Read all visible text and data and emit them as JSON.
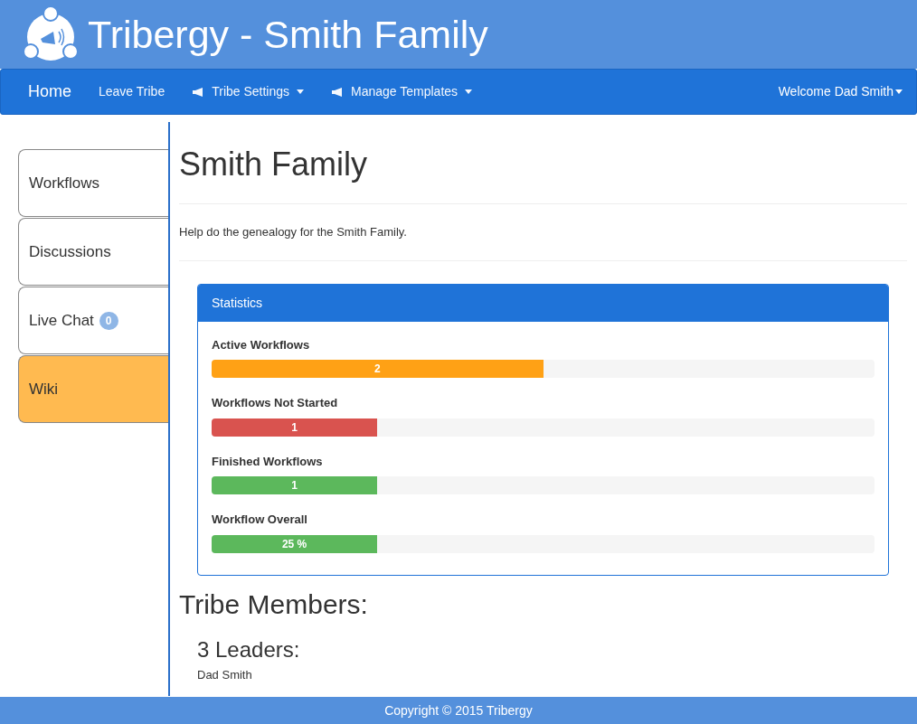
{
  "header": {
    "title": "Tribergy - Smith Family"
  },
  "navbar": {
    "items": [
      {
        "label": "Home",
        "selected": true,
        "icon": false,
        "dropdown": false
      },
      {
        "label": "Leave Tribe",
        "selected": false,
        "icon": false,
        "dropdown": false
      },
      {
        "label": "Tribe Settings",
        "selected": false,
        "icon": true,
        "dropdown": true
      },
      {
        "label": "Manage Templates",
        "selected": false,
        "icon": true,
        "dropdown": true
      }
    ],
    "user": {
      "label": "Welcome Dad Smith",
      "dropdown": true
    }
  },
  "sidebar": {
    "items": [
      {
        "label": "Workflows",
        "selected": false
      },
      {
        "label": "Discussions",
        "selected": false
      },
      {
        "label": "Live Chat",
        "selected": false,
        "badge": "0"
      },
      {
        "label": "Wiki",
        "selected": true
      }
    ]
  },
  "page": {
    "title": "Smith Family",
    "description": "Help do the genealogy for the Smith Family."
  },
  "statistics": {
    "title": "Statistics",
    "bars": [
      {
        "label": "Active Workflows",
        "value": "2",
        "level": 0.5,
        "color": "#ffa115"
      },
      {
        "label": "Workflows Not Started",
        "value": "1",
        "level": 0.25,
        "color": "#d9534f"
      },
      {
        "label": "Finished Workflows",
        "value": "1",
        "level": 0.25,
        "color": "#5cb85c"
      },
      {
        "label": "Workflow Overall",
        "value": "25 %",
        "level": 0.25,
        "color": "#5cb85c"
      }
    ]
  },
  "members": {
    "title": "Tribe Members:",
    "leaders_title": "3 Leaders:",
    "leaders": [
      "Dad Smith"
    ]
  },
  "footer": {
    "text": "Copyright © 2015 Tribergy"
  }
}
